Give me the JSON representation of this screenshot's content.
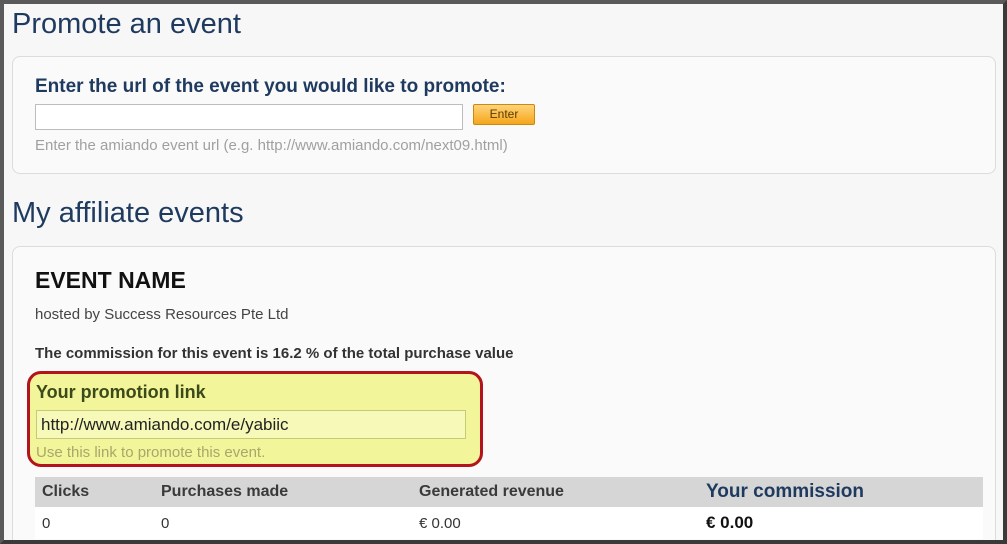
{
  "promote": {
    "heading": "Promote an event",
    "label": "Enter the url of the event you would like to promote:",
    "input_value": "",
    "enter_label": "Enter",
    "hint": "Enter the amiando event url (e.g. http://www.amiando.com/next09.html)"
  },
  "affiliate": {
    "heading": "My affiliate events",
    "event_name": "EVENT NAME",
    "hosted_by": "hosted by Success Resources Pte Ltd",
    "commission_text": "The commission for this event is 16.2 % of the total purchase value",
    "promo": {
      "title": "Your promotion link",
      "link": "http://www.amiando.com/e/yabiic",
      "hint": "Use this link to promote this event."
    },
    "table": {
      "headers": [
        "Clicks",
        "Purchases made",
        "Generated revenue",
        "Your commission"
      ],
      "row": [
        "0",
        "0",
        "€ 0.00",
        "€ 0.00"
      ]
    }
  },
  "colors": {
    "heading": "#1f3a5f",
    "highlight_bg": "#f2f59a",
    "highlight_border": "#b3141b",
    "enter_button": "#f6a61b"
  }
}
